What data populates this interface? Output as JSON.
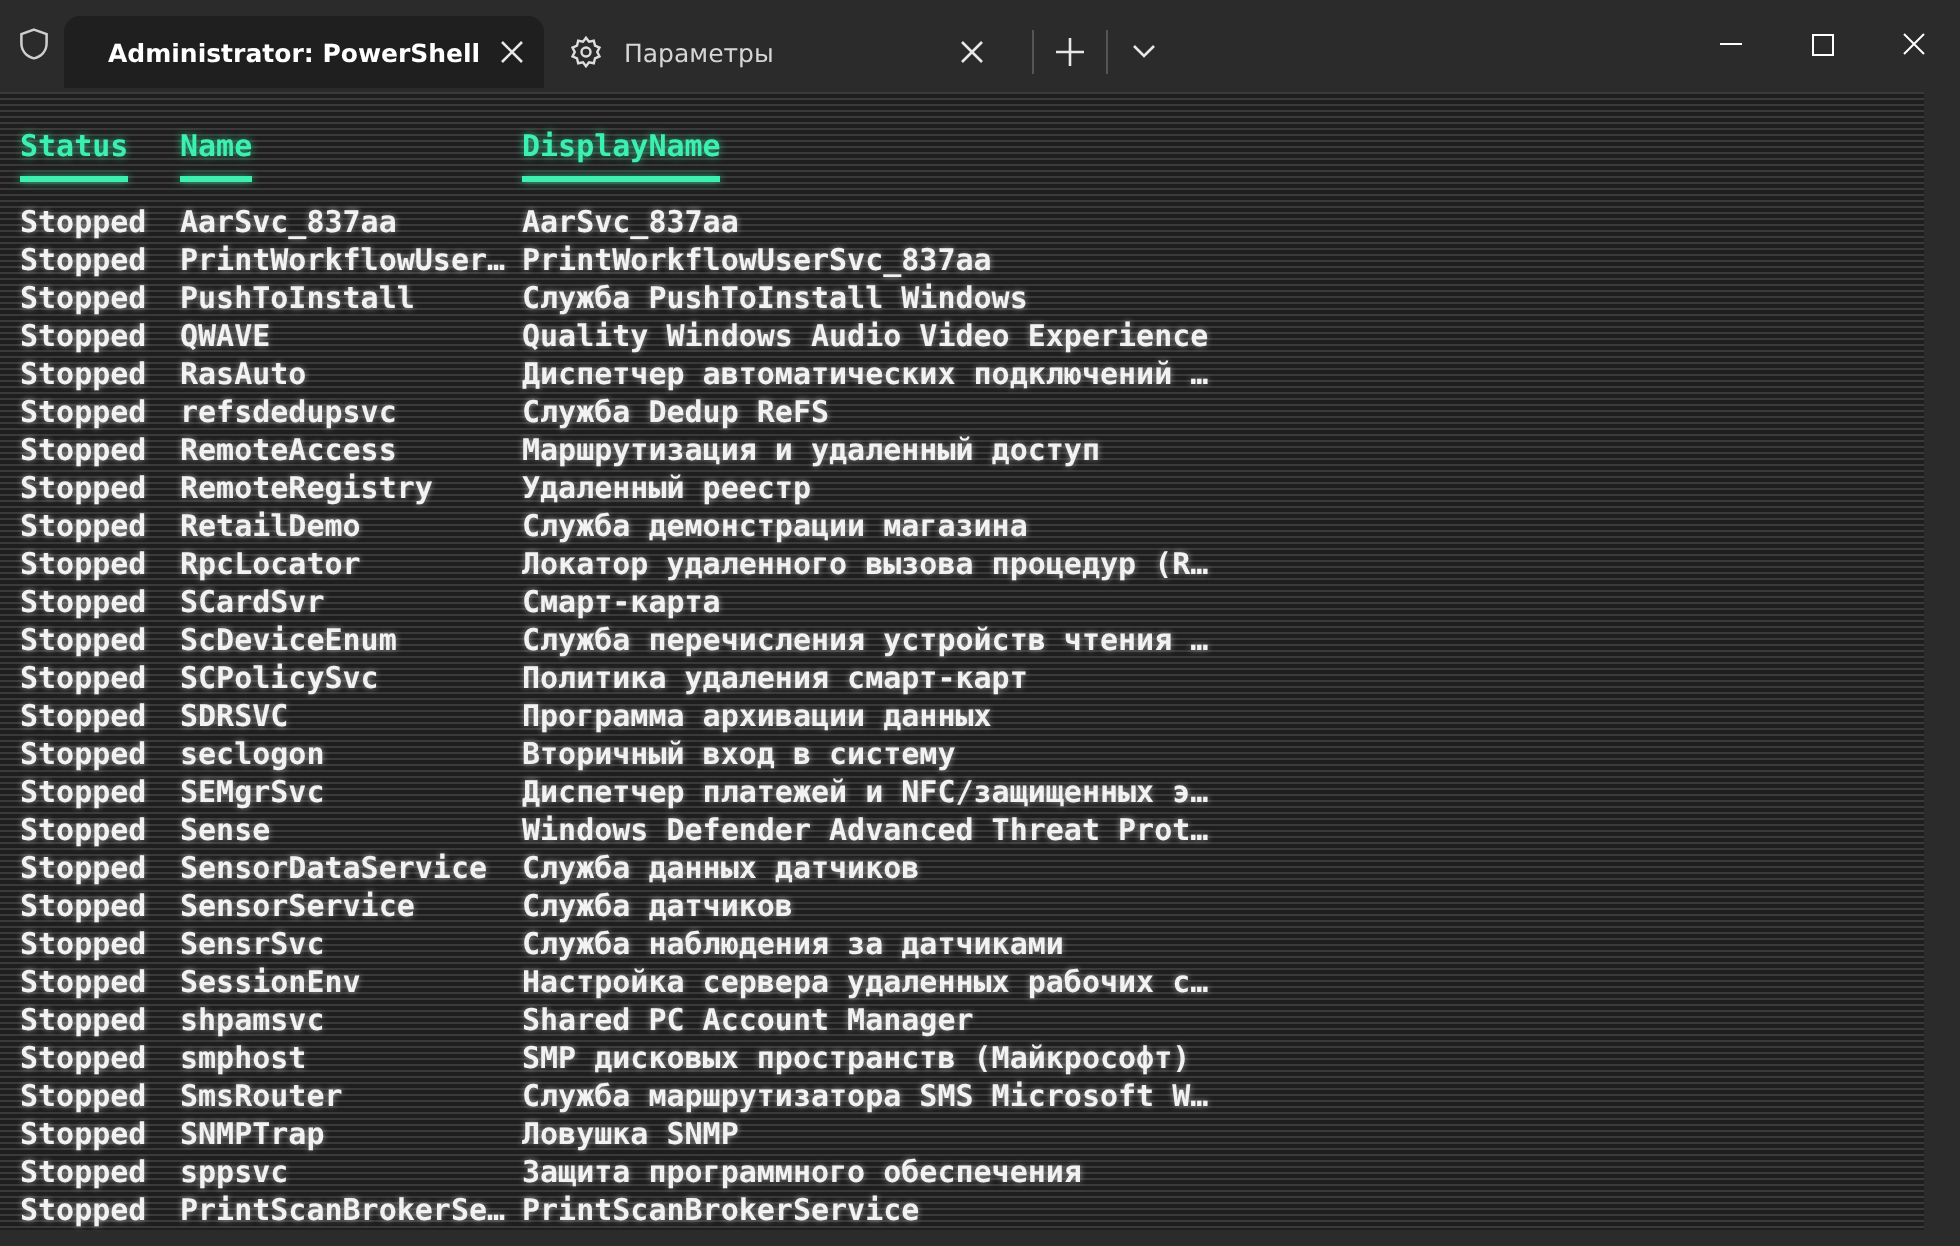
{
  "tabs": [
    {
      "kind": "powershell",
      "label": "Administrator: PowerShell",
      "selected": true
    },
    {
      "kind": "settings",
      "label": "Параметры",
      "selected": false
    }
  ],
  "table": {
    "columns": [
      "Status",
      "Name",
      "DisplayName"
    ],
    "rows": [
      {
        "status": "Stopped",
        "name": "AarSvc_837aa",
        "display_name": "AarSvc_837aa"
      },
      {
        "status": "Stopped",
        "name": "PrintWorkflowUser…",
        "display_name": "PrintWorkflowUserSvc_837aa"
      },
      {
        "status": "Stopped",
        "name": "PushToInstall",
        "display_name": "Служба PushToInstall Windows"
      },
      {
        "status": "Stopped",
        "name": "QWAVE",
        "display_name": "Quality Windows Audio Video Experience"
      },
      {
        "status": "Stopped",
        "name": "RasAuto",
        "display_name": "Диспетчер автоматических подключений …"
      },
      {
        "status": "Stopped",
        "name": "refsdedupsvc",
        "display_name": "Служба Dedup ReFS"
      },
      {
        "status": "Stopped",
        "name": "RemoteAccess",
        "display_name": "Маршрутизация и удаленный доступ"
      },
      {
        "status": "Stopped",
        "name": "RemoteRegistry",
        "display_name": "Удаленный реестр"
      },
      {
        "status": "Stopped",
        "name": "RetailDemo",
        "display_name": "Служба демонстрации магазина"
      },
      {
        "status": "Stopped",
        "name": "RpcLocator",
        "display_name": "Локатор удаленного вызова процедур (R…"
      },
      {
        "status": "Stopped",
        "name": "SCardSvr",
        "display_name": "Смарт-карта"
      },
      {
        "status": "Stopped",
        "name": "ScDeviceEnum",
        "display_name": "Служба перечисления устройств чтения …"
      },
      {
        "status": "Stopped",
        "name": "SCPolicySvc",
        "display_name": "Политика удаления смарт-карт"
      },
      {
        "status": "Stopped",
        "name": "SDRSVC",
        "display_name": "Программа архивации данных"
      },
      {
        "status": "Stopped",
        "name": "seclogon",
        "display_name": "Вторичный вход в систему"
      },
      {
        "status": "Stopped",
        "name": "SEMgrSvc",
        "display_name": "Диспетчер платежей и NFC/защищенных э…"
      },
      {
        "status": "Stopped",
        "name": "Sense",
        "display_name": "Windows Defender Advanced Threat Prot…"
      },
      {
        "status": "Stopped",
        "name": "SensorDataService",
        "display_name": "Служба данных датчиков"
      },
      {
        "status": "Stopped",
        "name": "SensorService",
        "display_name": "Служба датчиков"
      },
      {
        "status": "Stopped",
        "name": "SensrSvc",
        "display_name": "Служба наблюдения за датчиками"
      },
      {
        "status": "Stopped",
        "name": "SessionEnv",
        "display_name": "Настройка сервера удаленных рабочих с…"
      },
      {
        "status": "Stopped",
        "name": "shpamsvc",
        "display_name": "Shared PC Account Manager"
      },
      {
        "status": "Stopped",
        "name": "smphost",
        "display_name": "SMP дисковых пространств (Майкрософт)"
      },
      {
        "status": "Stopped",
        "name": "SmsRouter",
        "display_name": "Служба маршрутизатора SMS Microsoft W…"
      },
      {
        "status": "Stopped",
        "name": "SNMPTrap",
        "display_name": "Ловушка SNMP"
      },
      {
        "status": "Stopped",
        "name": "sppsvc",
        "display_name": "Защита программного обеспечения"
      },
      {
        "status": "Stopped",
        "name": "PrintScanBrokerSe…",
        "display_name": "PrintScanBrokerService"
      }
    ]
  }
}
